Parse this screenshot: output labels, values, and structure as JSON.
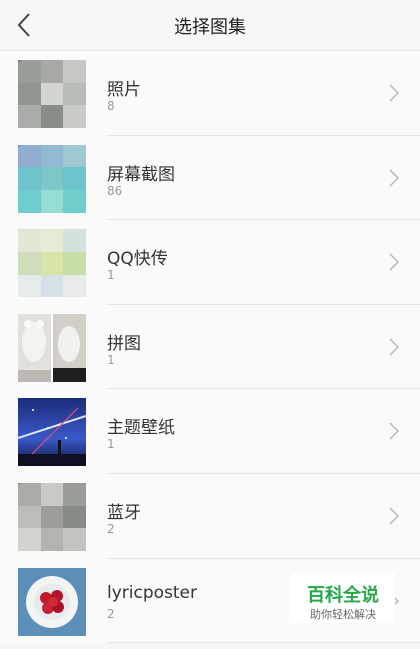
{
  "header": {
    "title": "选择图集",
    "back_icon": "chevron-left-icon"
  },
  "albums": [
    {
      "name": "照片",
      "count": "8",
      "thumb": "blurred-mosaic-gray"
    },
    {
      "name": "屏幕截图",
      "count": "86",
      "thumb": "blurred-mosaic-teal"
    },
    {
      "name": "QQ快传",
      "count": "1",
      "thumb": "blurred-mosaic-green"
    },
    {
      "name": "拼图",
      "count": "1",
      "thumb": "humidifier-collage"
    },
    {
      "name": "主题壁纸",
      "count": "1",
      "thumb": "night-sky-wallpaper"
    },
    {
      "name": "蓝牙",
      "count": "2",
      "thumb": "blurred-mosaic-gray"
    },
    {
      "name": "lyricposter",
      "count": "2",
      "thumb": "strawberries-plate"
    }
  ],
  "watermark": {
    "title": "百科全说",
    "subtitle": "助你轻松解决"
  },
  "colors": {
    "background": "#f7f7f7",
    "text": "#333333",
    "count": "#9a9a9a",
    "watermark": "#24a84a"
  }
}
